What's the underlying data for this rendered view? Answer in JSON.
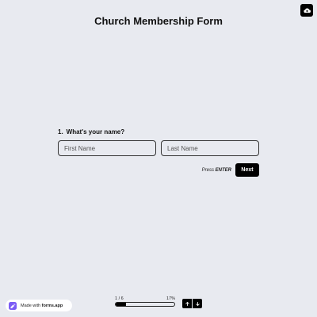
{
  "form": {
    "title": "Church Membership Form"
  },
  "question": {
    "number": "1.",
    "text": "What's your name?",
    "first_name_placeholder": "First Name",
    "first_name_value": "",
    "last_name_placeholder": "Last Name",
    "last_name_value": ""
  },
  "actions": {
    "hint_prefix": "Press",
    "hint_key": "ENTER",
    "next_label": "Next"
  },
  "footer": {
    "made_with_prefix": "Made with",
    "made_with_brand": "forms.app",
    "progress_label": "1 / 6",
    "progress_percent_label": "17%",
    "progress_fraction": 0.17
  },
  "icons": {
    "save": "cloud-upload-icon",
    "up": "arrow-up-icon",
    "down": "arrow-down-icon",
    "logo": "forms-app-logo-icon"
  },
  "colors": {
    "background": "#e8eaf0",
    "primary": "#000000",
    "logo_accent": "#7b5cf5"
  }
}
